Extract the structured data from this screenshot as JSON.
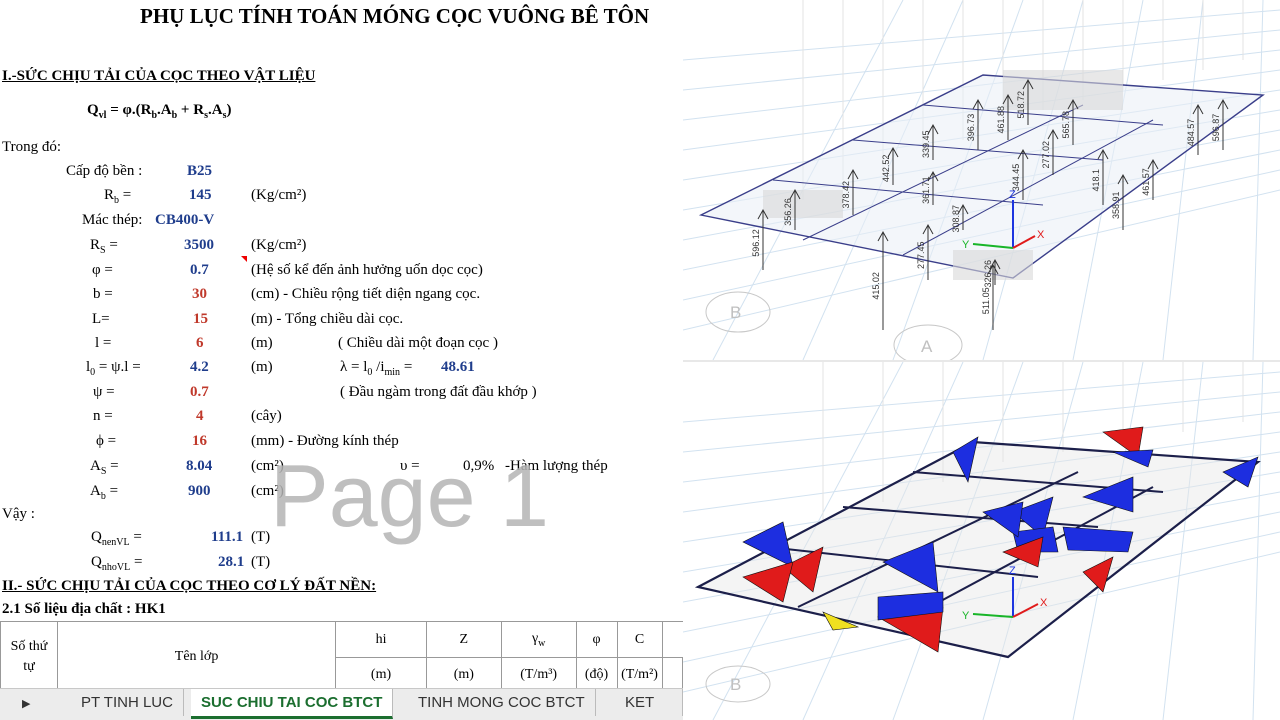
{
  "sheet": {
    "title": "PHỤ LỤC TÍNH TOÁN MÓNG CỌC VUÔNG BÊ TÔN",
    "section1_heading": "I.-SỨC CHỊU TẢI CỦA CỌC THEO VẬT LIỆU",
    "formula": "Qvl = φ.(Rb.Ab + Rs.As)",
    "trong_do": "Trong đó:",
    "params": [
      {
        "label": "Cấp độ bền :",
        "value": "B25",
        "unit": ""
      },
      {
        "label": "Rb =",
        "value": "145",
        "unit": "(Kg/cm²)"
      },
      {
        "label": "Mác thép:",
        "value": "CB400-V",
        "unit": ""
      },
      {
        "label": "Rs =",
        "value": "3500",
        "unit": "(Kg/cm²)"
      },
      {
        "label": "φ =",
        "value": "0.7",
        "unit": "(Hệ số kể đến ảnh hưởng uốn dọc cọc)"
      },
      {
        "label": "b =",
        "value": "30",
        "unit": "(cm) - Chiều rộng tiết diện ngang cọc."
      },
      {
        "label": "L=",
        "value": "15",
        "unit": "(m) - Tổng chiều dài cọc."
      },
      {
        "label": "l =",
        "value": "6",
        "unit": "(m)",
        "note": "( Chiều dài một đoạn cọc )"
      },
      {
        "label": "l0 = ψ.l =",
        "value": "4.2",
        "unit": "(m)",
        "note_label": "λ = l0 /imin =",
        "note_value": "48.61"
      },
      {
        "label": "ψ =",
        "value": "0.7",
        "unit": "",
        "note": "( Đầu ngàm trong đất  đầu khớp )"
      },
      {
        "label": "n =",
        "value": "4",
        "unit": "(cây)"
      },
      {
        "label": "ϕ =",
        "value": "16",
        "unit": "(mm) - Đường kính thép"
      },
      {
        "label": "As =",
        "value": "8.04",
        "unit": "(cm²)",
        "note_label": "υ =",
        "note_value": "0,9%",
        "note_desc": "-Hàm lượng thép"
      },
      {
        "label": "Ab =",
        "value": "900",
        "unit": "(cm²)"
      }
    ],
    "vay": "Vậy :",
    "results": [
      {
        "label": "QnenVL =",
        "value": "111.1",
        "unit": "(T)"
      },
      {
        "label": "QnhoVL =",
        "value": "28.1",
        "unit": "(T)"
      }
    ],
    "section2_heading": "II.- SỨC CHỊU TẢI CỦA CỌC THEO CƠ LÝ ĐẤT NỀN:",
    "section21": "2.1 Số liệu địa chất : HK1",
    "watermark": "Page 1",
    "table_header": {
      "col1": "Số thứ tự",
      "col2": "Tên lớp",
      "cols": [
        {
          "name": "hi",
          "unit": "(m)"
        },
        {
          "name": "Z",
          "unit": "(m)"
        },
        {
          "name": "γw",
          "unit": "(T/m³)"
        },
        {
          "name": "φ",
          "unit": "(độ)"
        },
        {
          "name": "C",
          "unit": "(T/m²)"
        }
      ]
    }
  },
  "tabs": [
    {
      "label": "PT TINH LUC",
      "active": false
    },
    {
      "label": "SUC CHIU TAI COC BTCT",
      "active": true
    },
    {
      "label": "TINH MONG COC BTCT",
      "active": false
    },
    {
      "label": "KET CAU",
      "active": false
    }
  ],
  "model_top": {
    "reaction_labels": [
      "596.12",
      "356.26",
      "415.02",
      "277.45",
      "511.05",
      "326.26",
      "308.87",
      "361.71",
      "378.42",
      "442.52",
      "339.45",
      "518.72",
      "461.88",
      "344.45",
      "396.73",
      "277.02",
      "565.78",
      "358.91",
      "461.57",
      "418.1",
      "596.87",
      "484.57"
    ],
    "axis_labels": {
      "z": "Z",
      "x": "X",
      "y": "Y"
    },
    "grid_labels": [
      "B",
      "A"
    ]
  },
  "model_bottom": {
    "axis_labels": {
      "z": "Z",
      "x": "X",
      "y": "Y"
    },
    "grid_labels": [
      "B"
    ],
    "colors": {
      "positive": "#e01b1b",
      "negative": "#1d2ee0",
      "highlight": "#f0e020"
    }
  }
}
